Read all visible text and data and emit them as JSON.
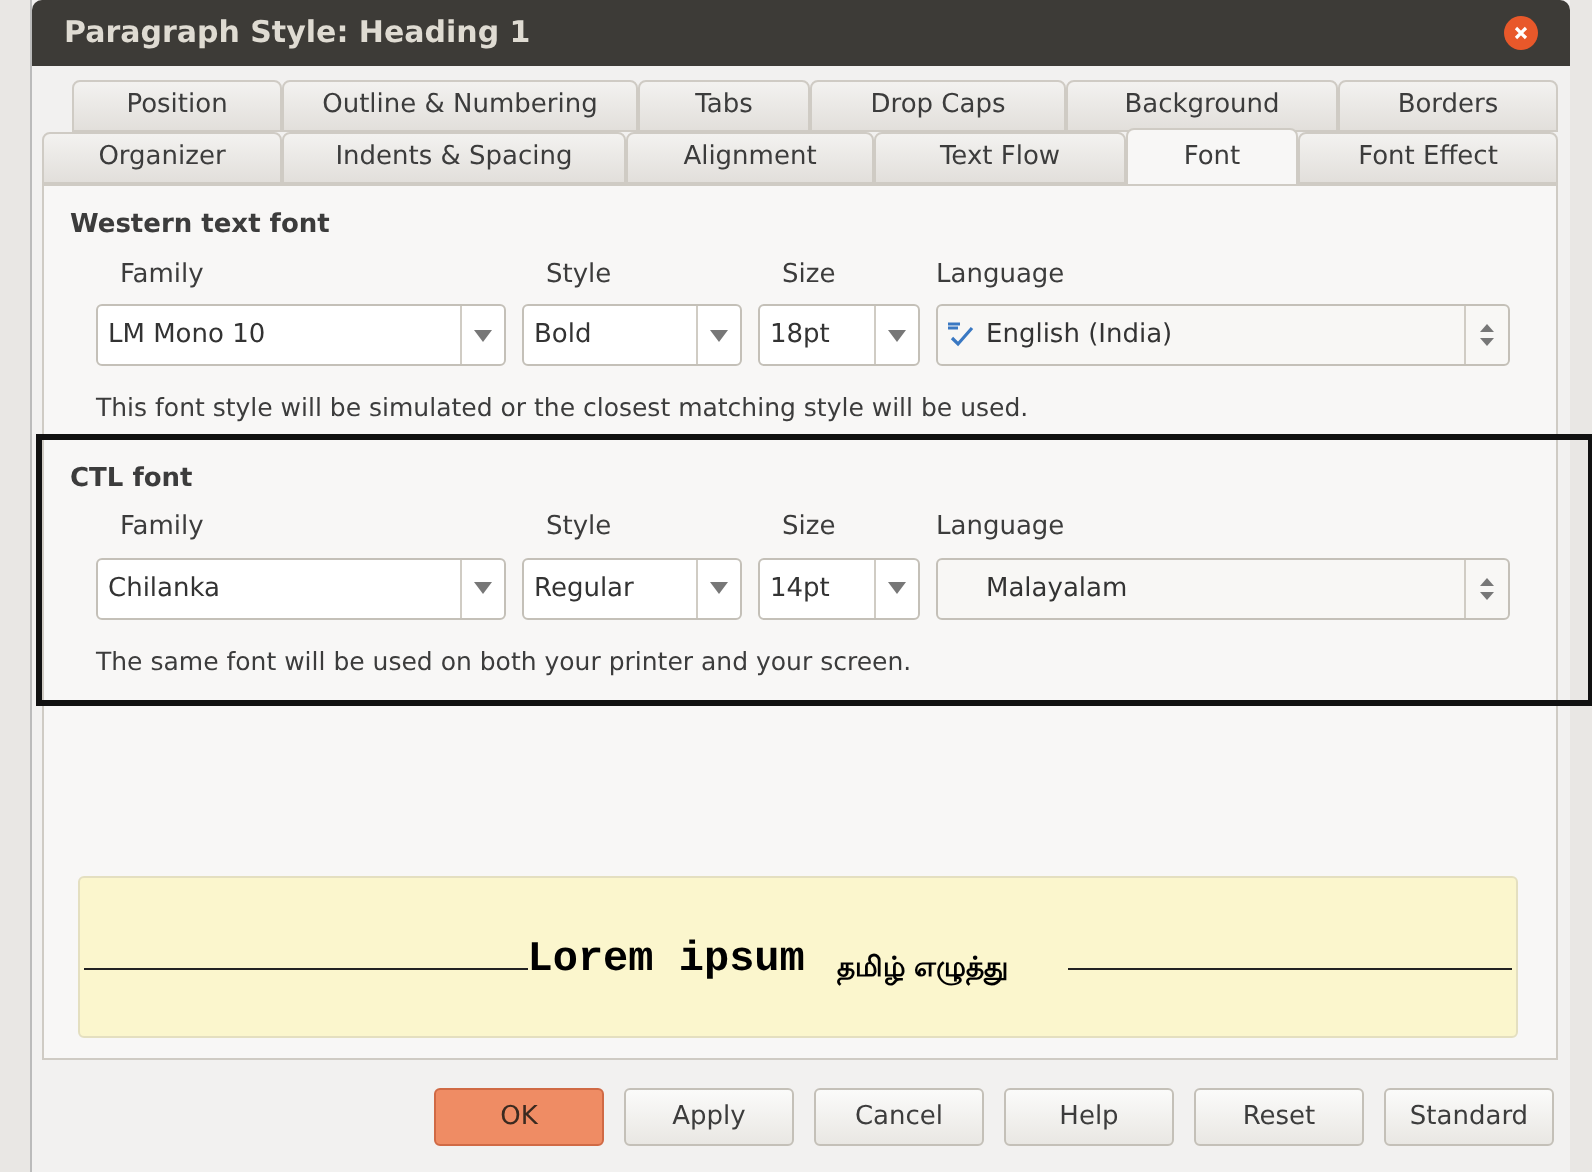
{
  "window": {
    "title": "Paragraph Style: Heading 1"
  },
  "tab_rows": [
    [
      {
        "label": "Position",
        "selected": false
      },
      {
        "label": "Outline & Numbering",
        "selected": false
      },
      {
        "label": "Tabs",
        "selected": false
      },
      {
        "label": "Drop Caps",
        "selected": false
      },
      {
        "label": "Background",
        "selected": false
      },
      {
        "label": "Borders",
        "selected": false
      }
    ],
    [
      {
        "label": "Organizer",
        "selected": false
      },
      {
        "label": "Indents & Spacing",
        "selected": false
      },
      {
        "label": "Alignment",
        "selected": false
      },
      {
        "label": "Text Flow",
        "selected": false
      },
      {
        "label": "Font",
        "selected": true
      },
      {
        "label": "Font Effect",
        "selected": false
      }
    ]
  ],
  "sections": [
    {
      "title": "Western text font",
      "highlighted": false,
      "family": {
        "label": "Family",
        "value": "LM Mono 10"
      },
      "style": {
        "label": "Style",
        "value": "Bold"
      },
      "size": {
        "label": "Size",
        "value": "18pt"
      },
      "language": {
        "label": "Language",
        "value": "English (India)",
        "spellcheck": true
      },
      "note": "This font style will be simulated or the closest matching style will be used."
    },
    {
      "title": "CTL font",
      "highlighted": true,
      "family": {
        "label": "Family",
        "value": "Chilanka"
      },
      "style": {
        "label": "Style",
        "value": "Regular"
      },
      "size": {
        "label": "Size",
        "value": "14pt"
      },
      "language": {
        "label": "Language",
        "value": "Malayalam",
        "spellcheck": false
      },
      "note": "The same font will be used on both your printer and your screen."
    }
  ],
  "preview": {
    "western_text": "Lorem ipsum",
    "ctl_text": "தமிழ் எழுத்து"
  },
  "buttons": [
    {
      "label": "OK",
      "default": true
    },
    {
      "label": "Apply",
      "default": false
    },
    {
      "label": "Cancel",
      "default": false
    },
    {
      "label": "Help",
      "default": false
    },
    {
      "label": "Reset",
      "default": false
    },
    {
      "label": "Standard",
      "default": false
    }
  ]
}
